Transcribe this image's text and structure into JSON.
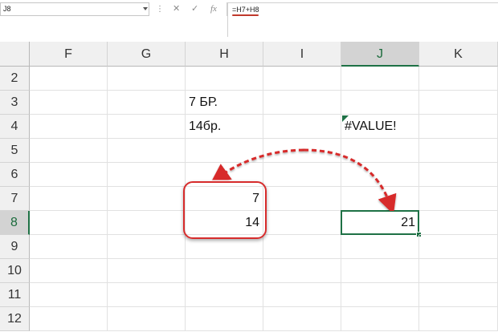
{
  "formula_bar": {
    "name_box": "J8",
    "cancel_glyph": "✕",
    "enter_glyph": "✓",
    "fx_label": "fx",
    "dots": "⋮",
    "formula": "=H7+H8"
  },
  "columns": [
    "F",
    "G",
    "H",
    "I",
    "J",
    "K"
  ],
  "rows": [
    "2",
    "3",
    "4",
    "5",
    "6",
    "7",
    "8",
    "9",
    "10",
    "11",
    "12"
  ],
  "cells": {
    "H3": "7 БР.",
    "H4": "14бр.",
    "J4": "#VALUE!",
    "H7": "7",
    "H8": "14",
    "J8": "21"
  },
  "active_cell": "J8",
  "colors": {
    "selection": "#1e7145",
    "callout": "#d72c2c",
    "formula_underline": "#c0392b"
  }
}
